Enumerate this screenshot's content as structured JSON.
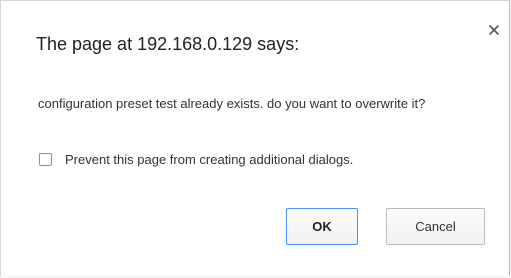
{
  "dialog": {
    "title": "The page at 192.168.0.129 says:",
    "message": "configuration preset test already exists. do you want to overwrite it?",
    "close_icon": "close-icon",
    "prevent_dialogs": {
      "label": "Prevent this page from creating additional dialogs.",
      "checked": false
    },
    "buttons": {
      "ok_label": "OK",
      "cancel_label": "Cancel"
    }
  },
  "colors": {
    "ok_border": "#4d90fe",
    "text": "#333333"
  }
}
